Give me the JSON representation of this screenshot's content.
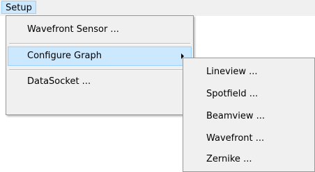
{
  "menubar": {
    "setup_label": "Setup"
  },
  "setup_menu": {
    "items": [
      {
        "label": "Wavefront Sensor ..."
      },
      {
        "label": "Configure Graph"
      },
      {
        "label": "DataSocket ..."
      }
    ]
  },
  "graph_submenu": {
    "items": [
      {
        "label": "Lineview ..."
      },
      {
        "label": "Spotfield ..."
      },
      {
        "label": "Beamview ..."
      },
      {
        "label": "Wavefront ..."
      },
      {
        "label": "Zernike ..."
      }
    ]
  },
  "colors": {
    "menu_background": "#f0f0f0",
    "highlight": "#cce8ff",
    "highlight_border": "#99d1ff"
  },
  "icons": {
    "submenu_arrow": "chevron-right-icon"
  }
}
